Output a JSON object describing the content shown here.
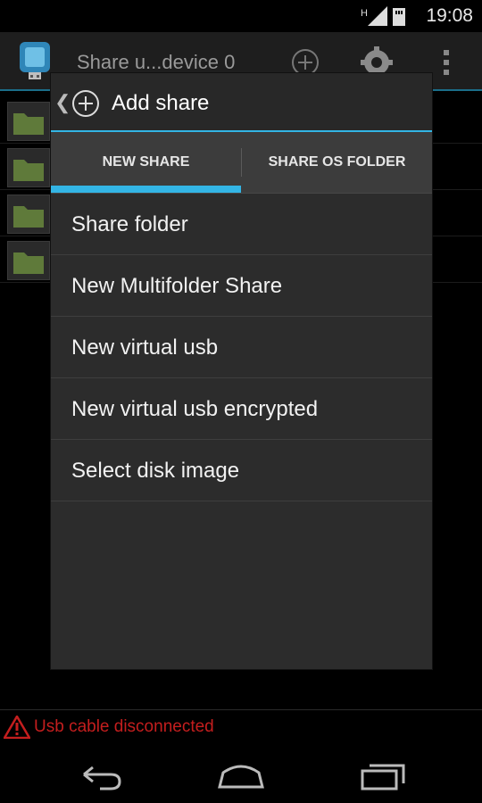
{
  "status_bar": {
    "time": "19:08",
    "network_label": "H"
  },
  "app_bar": {
    "title": "Share u...device 0"
  },
  "status_message": "Usb cable disconnected",
  "dialog": {
    "title": "Add share",
    "tabs": [
      {
        "label": "NEW SHARE",
        "selected": true
      },
      {
        "label": "SHARE OS FOLDER",
        "selected": false
      }
    ],
    "items": [
      {
        "label": "Share folder"
      },
      {
        "label": "New Multifolder Share"
      },
      {
        "label": "New virtual usb"
      },
      {
        "label": "New virtual usb encrypted"
      },
      {
        "label": "Select disk image"
      }
    ]
  },
  "colors": {
    "accent": "#33b5e5",
    "error": "#c41e1e",
    "dialog_bg": "#2c2c2c",
    "tab_bg": "#3c3c3c"
  },
  "icons": [
    "back-chevron-icon",
    "add-circle-icon",
    "settings-gear-icon",
    "overflow-menu-icon",
    "folder-icon",
    "warning-icon",
    "nav-back-icon",
    "nav-home-icon",
    "nav-recents-icon",
    "signal-icon",
    "sd-card-icon"
  ]
}
